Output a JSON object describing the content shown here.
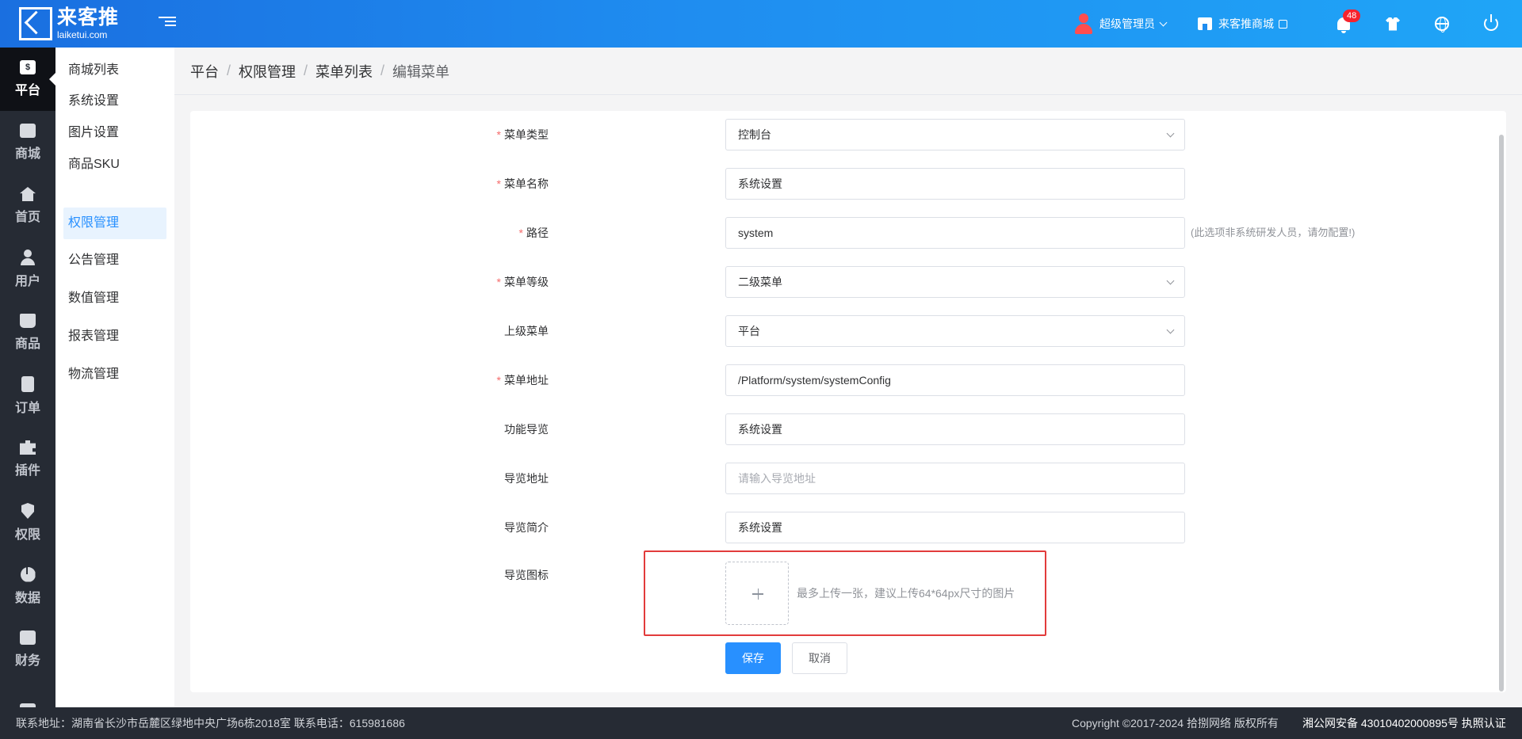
{
  "header": {
    "logo_cn": "来客推",
    "logo_en": "laiketui.com",
    "user_name": "超级管理员",
    "store_label": "来客推商城",
    "notification_count": "48"
  },
  "sidebar_main": [
    {
      "label": "平台",
      "icon": "dollar-icon",
      "active": true
    },
    {
      "label": "商城",
      "icon": "store-icon"
    },
    {
      "label": "首页",
      "icon": "home-icon"
    },
    {
      "label": "用户",
      "icon": "user-icon"
    },
    {
      "label": "商品",
      "icon": "bag-icon"
    },
    {
      "label": "订单",
      "icon": "clipboard-icon"
    },
    {
      "label": "插件",
      "icon": "puzzle-icon"
    },
    {
      "label": "权限",
      "icon": "shield-icon"
    },
    {
      "label": "数据",
      "icon": "pie-chart-icon"
    },
    {
      "label": "财务",
      "icon": "wallet-icon"
    }
  ],
  "sidebar_sub": [
    {
      "label": "商城列表"
    },
    {
      "label": "系统设置"
    },
    {
      "label": "图片设置"
    },
    {
      "label": "商品SKU"
    },
    {
      "label": "权限管理",
      "active": true
    },
    {
      "label": "公告管理"
    },
    {
      "label": "数值管理"
    },
    {
      "label": "报表管理"
    },
    {
      "label": "物流管理"
    }
  ],
  "breadcrumb": [
    "平台",
    "权限管理",
    "菜单列表",
    "编辑菜单"
  ],
  "breadcrumb_separator": "/",
  "form": {
    "required_mark": "*",
    "menu_type": {
      "label": "菜单类型",
      "value": "控制台"
    },
    "menu_name": {
      "label": "菜单名称",
      "value": "系统设置"
    },
    "path": {
      "label": "路径",
      "value": "system",
      "hint": "(此选项非系统研发人员，请勿配置!)"
    },
    "menu_level": {
      "label": "菜单等级",
      "value": "二级菜单"
    },
    "parent_menu": {
      "label": "上级菜单",
      "value": "平台"
    },
    "menu_url": {
      "label": "菜单地址",
      "value": "/Platform/system/systemConfig"
    },
    "nav_function": {
      "label": "功能导览",
      "value": "系统设置"
    },
    "nav_url": {
      "label": "导览地址",
      "value": "",
      "placeholder": "请输入导览地址"
    },
    "nav_intro": {
      "label": "导览简介",
      "value": "系统设置"
    },
    "nav_icon": {
      "label": "导览图标",
      "tip": "最多上传一张，建议上传64*64px尺寸的图片"
    },
    "save_label": "保存",
    "cancel_label": "取消"
  },
  "footer": {
    "address": "联系地址：湖南省长沙市岳麓区绿地中央广场6栋2018室 联系电话：615981686",
    "copyright": "Copyright ©2017-2024 拾捌网络 版权所有",
    "icp": "湘公网安备 43010402000895号 执照认证"
  },
  "colors": {
    "primary": "#2890ff",
    "header_gradient_start": "#1a6fe0",
    "header_gradient_end": "#1fa5f7",
    "sidebar_dark": "#262b34",
    "highlight_red": "#e23b3b"
  }
}
